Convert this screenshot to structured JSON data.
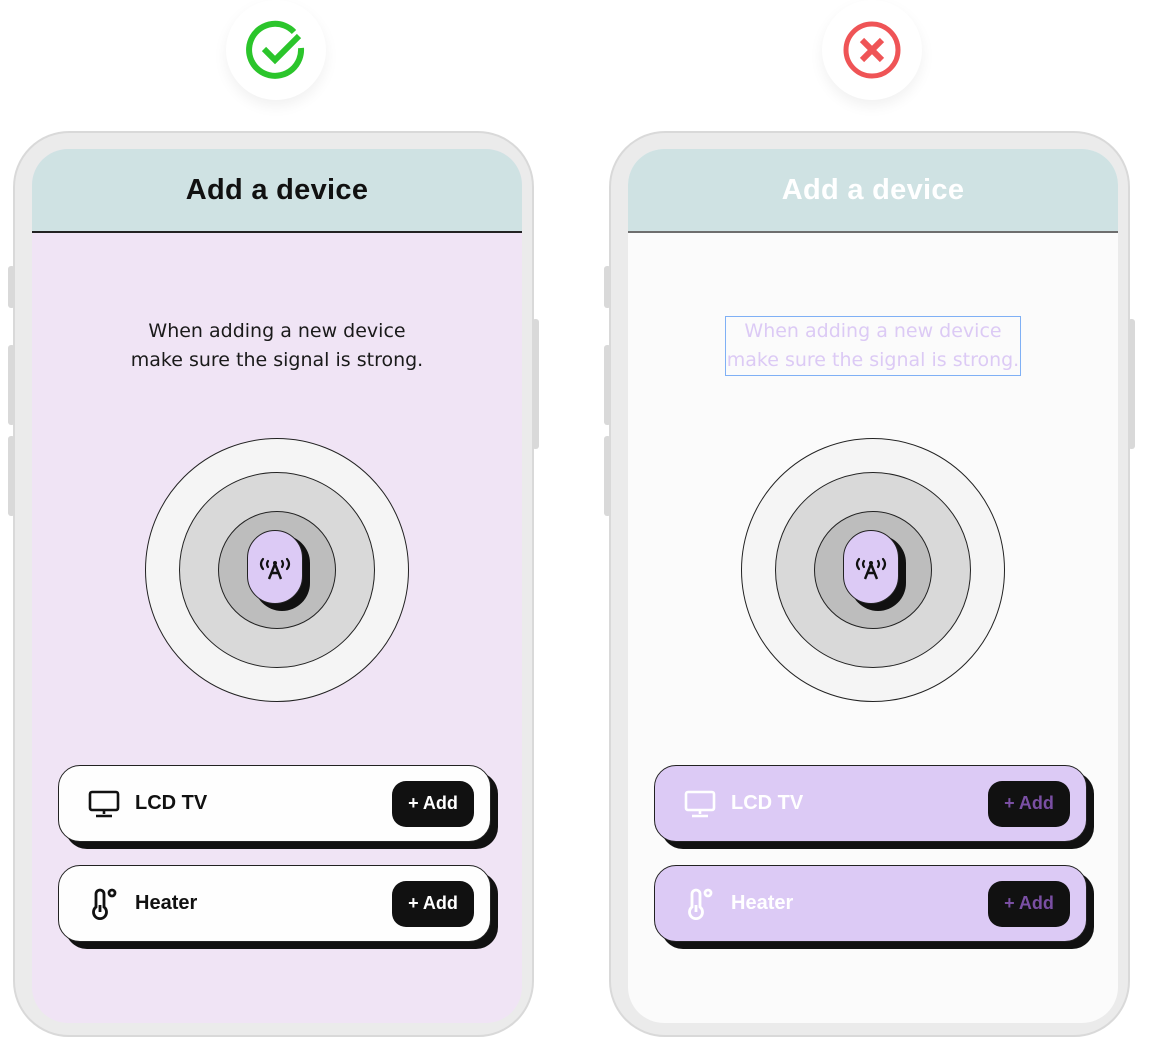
{
  "badges": {
    "good": {
      "icon": "check-circle-icon",
      "color": "#2bc52b"
    },
    "bad": {
      "icon": "x-circle-icon",
      "color": "#ef5456"
    }
  },
  "good_example": {
    "title": "Add a device",
    "hint_line1": "When adding a new device",
    "hint_line2": "make sure the signal is strong.",
    "center_icon": "antenna-signal-icon",
    "devices": [
      {
        "icon": "tv-icon",
        "label": "LCD TV",
        "button": "+ Add"
      },
      {
        "icon": "thermometer-icon",
        "label": "Heater",
        "button": "+ Add"
      }
    ],
    "colors": {
      "header": "#cfe2e3",
      "background": "#f0e4f5",
      "card": "#fefefe",
      "text": "#111111",
      "button": "#111111",
      "button_text": "#ffffff"
    }
  },
  "bad_example": {
    "title": "Add a device",
    "hint_line1": "When adding a new device",
    "hint_line2": "make sure the signal is strong.",
    "center_icon": "antenna-signal-icon",
    "devices": [
      {
        "icon": "tv-icon",
        "label": "LCD TV",
        "button": "+ Add"
      },
      {
        "icon": "thermometer-icon",
        "label": "Heater",
        "button": "+ Add"
      }
    ],
    "colors": {
      "header": "#cfe2e3",
      "background": "#fbfbfb",
      "card": "#dccaf5",
      "text": "#ffffff",
      "hint_text": "#dccaf5",
      "button": "#111111",
      "button_text": "#7a4fa3"
    }
  }
}
